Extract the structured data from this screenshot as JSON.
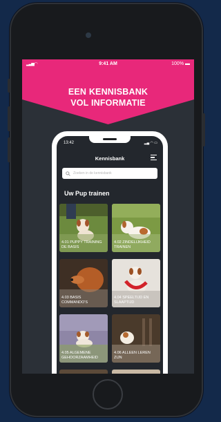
{
  "outer_status": {
    "time": "9:41 AM",
    "battery": "100%"
  },
  "banner": {
    "line1": "EEN KENNISBANK",
    "line2": "VOL INFORMATIE"
  },
  "inner": {
    "time": "13:42",
    "title": "Kennisbank",
    "search_placeholder": "Zoeken in de kennisbank",
    "section_title": "Uw Pup trainen",
    "cards": [
      {
        "label": "4.01 PUPPY TRAINING DE BASIS",
        "icon": "puppy-grass-photo"
      },
      {
        "label": "4.02 ZINDELIJKHEID TRAINEN",
        "icon": "puppy-white-photo"
      },
      {
        "label": "4.03 BASIS COMMANDO'S",
        "icon": "dog-red-photo"
      },
      {
        "label": "4.04 SPEELTIJD EN SLAAPTIJD",
        "icon": "puppy-toy-photo"
      },
      {
        "label": "4.05 ALGEMENE GEHOORZAAMHEID",
        "icon": "puppy-flowers-photo"
      },
      {
        "label": "4.06 ALLEEN LEREN ZIJN",
        "icon": "puppy-house-photo"
      }
    ]
  },
  "colors": {
    "brand_pink": "#e8287a",
    "background": "#13294a"
  }
}
